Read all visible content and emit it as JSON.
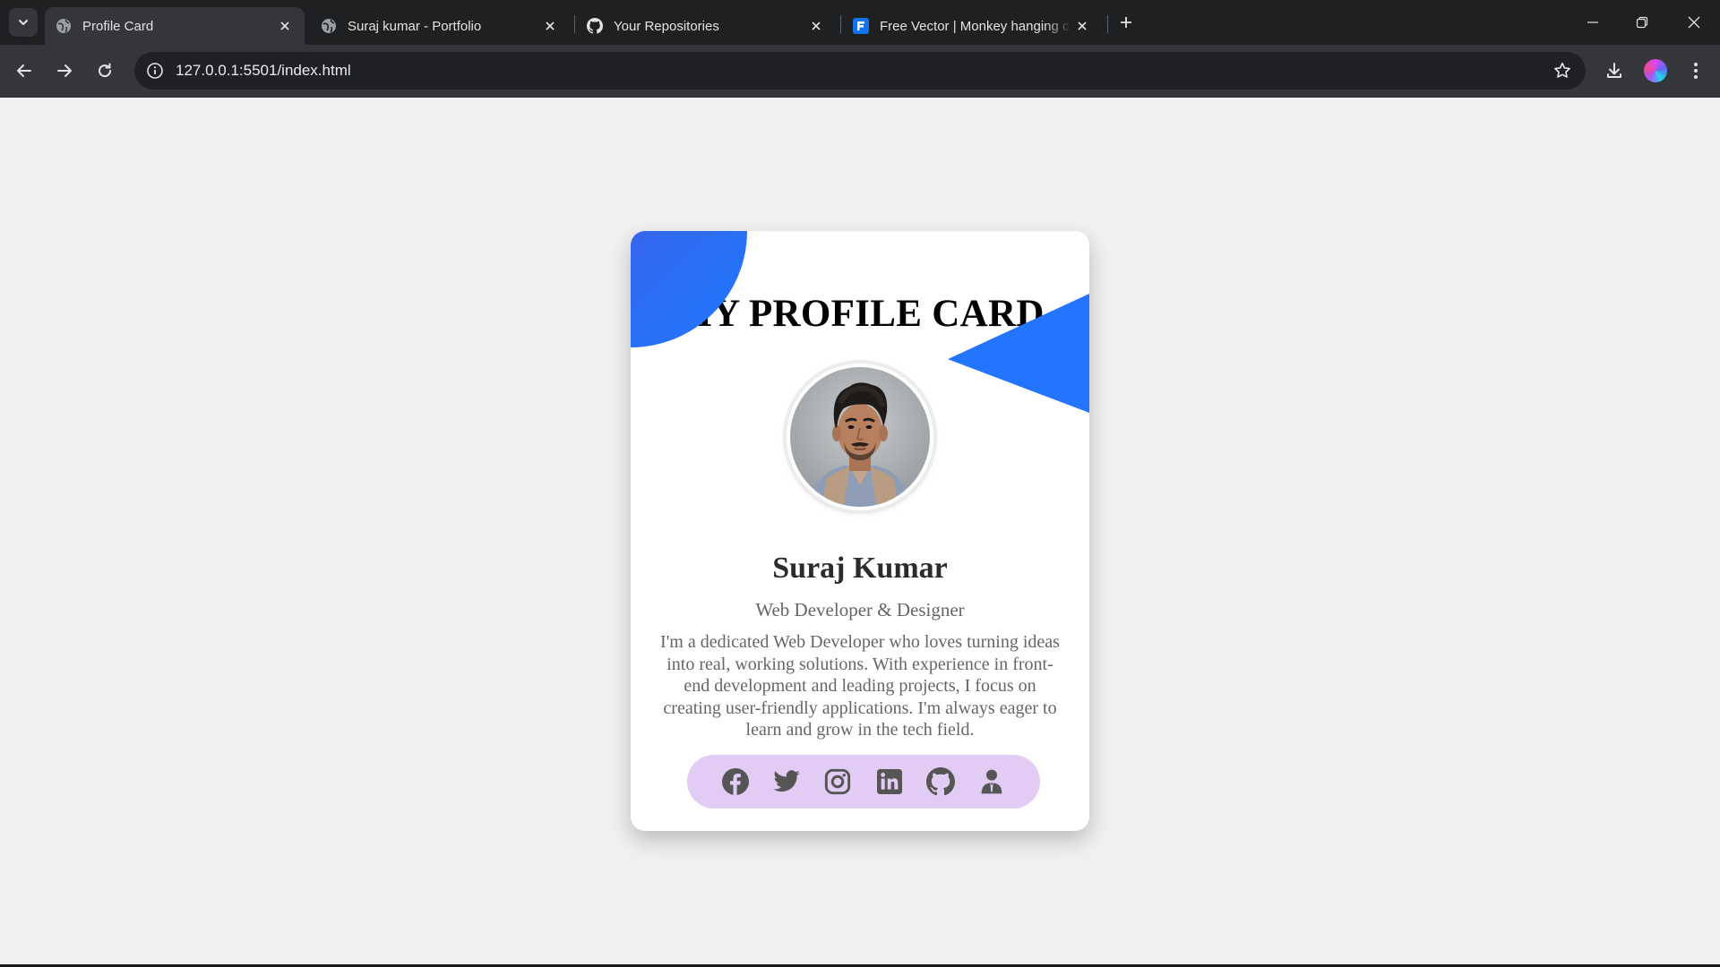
{
  "browser": {
    "tabs": [
      {
        "title": "Profile Card",
        "favicon": "globe-icon",
        "active": true
      },
      {
        "title": "Suraj kumar - Portfolio",
        "favicon": "globe-icon",
        "active": false
      },
      {
        "title": "Your Repositories",
        "favicon": "github-icon",
        "active": false
      },
      {
        "title": "Free Vector | Monkey hanging c",
        "favicon": "freepik-icon",
        "active": false
      }
    ],
    "url": "127.0.0.1:5501/index.html"
  },
  "card": {
    "title": "MY PROFILE CARD",
    "name": "Suraj Kumar",
    "role": "Web Developer & Designer",
    "bio": "I'm a dedicated Web Developer who loves turning ideas into real, working solutions. With experience in front-end development and leading projects, I focus on creating user-friendly applications. I'm always eager to learn and grow in the tech field.",
    "socials": [
      "facebook-icon",
      "twitter-icon",
      "instagram-icon",
      "linkedin-icon",
      "github-icon",
      "user-profile-icon"
    ]
  },
  "colors": {
    "accent_blue": "#2374ff",
    "blob_gradient_start": "#5b3fdc",
    "social_bar_bg": "#e3ccf4",
    "social_icon": "#555555",
    "page_bg": "#f0f0f0"
  }
}
